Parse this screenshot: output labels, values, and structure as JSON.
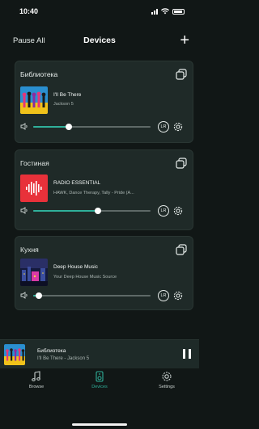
{
  "status_bar": {
    "time": "10:40"
  },
  "top_bar": {
    "pause_all": "Pause All",
    "title": "Devices",
    "add_symbol": "+"
  },
  "colors": {
    "accent": "#2fb09a",
    "background": "#111716",
    "card": "#1f2a28"
  },
  "cards": [
    {
      "room": "Библиотека",
      "track_title": "I'll Be There",
      "track_subtitle": "Jackson 5",
      "art": "colorful-figures-art",
      "volume_fraction": 0.3,
      "lr_label": "LR"
    },
    {
      "room": "Гостиная",
      "track_title": "RADIO ESSENTIAL",
      "track_subtitle": "HAWK, Dance Therapy, Tally - Pride (A...",
      "art": "red-waveform-art",
      "volume_fraction": 0.55,
      "lr_label": "LR"
    },
    {
      "room": "Кухня",
      "track_title": "Deep House Music",
      "track_subtitle": "Your Deep House Music Source",
      "art": "night-city-art",
      "volume_fraction": 0.05,
      "lr_label": "LR"
    }
  ],
  "mini_player": {
    "room": "Библиотека",
    "track": "I'll Be There - Jackson 5"
  },
  "tabs": [
    {
      "label": "Browse",
      "icon": "music-note-icon"
    },
    {
      "label": "Devices",
      "icon": "speaker-icon"
    },
    {
      "label": "Settings",
      "icon": "gear-icon"
    }
  ]
}
